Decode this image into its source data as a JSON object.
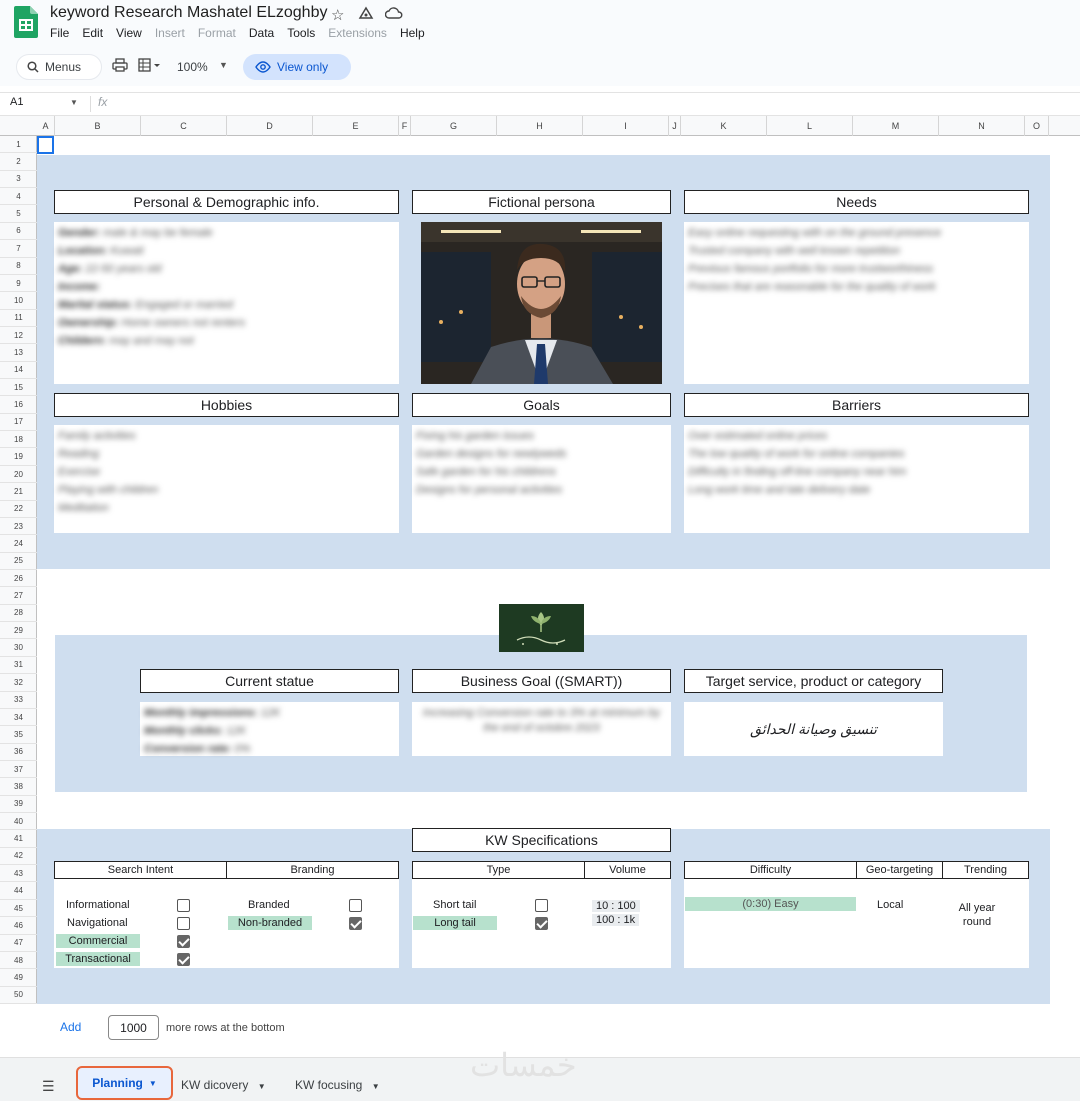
{
  "app": {
    "title": "keyword Research Mashatel ELzoghby",
    "menu": [
      "File",
      "Edit",
      "View",
      "Insert",
      "Format",
      "Data",
      "Tools",
      "Extensions",
      "Help"
    ],
    "menu_disabled": [
      "Insert",
      "Format",
      "Extensions"
    ],
    "menus_label": "Menus",
    "zoom": "100%",
    "view_only": "View only",
    "cell_ref": "A1",
    "fx": "fx"
  },
  "columns": [
    "A",
    "B",
    "C",
    "D",
    "E",
    "F",
    "G",
    "H",
    "I",
    "J",
    "K",
    "L",
    "M",
    "N",
    "O"
  ],
  "rows": [
    "1",
    "2",
    "3",
    "4",
    "5",
    "6",
    "7",
    "8",
    "9",
    "10",
    "11",
    "12",
    "13",
    "14",
    "15",
    "16",
    "17",
    "18",
    "19",
    "20",
    "21",
    "22",
    "23",
    "24",
    "25",
    "26",
    "27",
    "28",
    "29",
    "30",
    "31",
    "32",
    "33",
    "34",
    "35",
    "36",
    "37",
    "38",
    "39",
    "40",
    "41",
    "42",
    "43",
    "44",
    "45",
    "46",
    "47",
    "48",
    "49",
    "50"
  ],
  "persona": {
    "personal_title": "Personal & Demographic info.",
    "persona_title": "Fictional persona",
    "needs_title": "Needs",
    "hobbies_title": "Hobbies",
    "goals_title": "Goals",
    "barriers_title": "Barriers",
    "personal_lines": [
      {
        "k": "Gender:",
        "v": "male & may be female"
      },
      {
        "k": "Location:",
        "v": "Kuwait"
      },
      {
        "k": "Age:",
        "v": "22-50 years old"
      },
      {
        "k": "Income:",
        "v": ""
      },
      {
        "k": "Marital status:",
        "v": "Engaged or married"
      },
      {
        "k": "Ownership:",
        "v": "Home owners not renters"
      },
      {
        "k": "Childern:",
        "v": "may and may not"
      }
    ],
    "needs_lines": [
      "Easy online requesting with on the ground presence",
      "Trusted company with well known repetition",
      "Previous famous portfolio for more trustworthiness",
      "Precises that are reasonable for the quality of work"
    ],
    "hobbies_lines": [
      "Family activities",
      "Reading",
      "Exercise",
      "Playing with children",
      "Meditation"
    ],
    "goals_lines": [
      "Fixing his garden issues",
      "Garden designs for newlyweds",
      "Safe garden for his childrens",
      "Designs for personal activities"
    ],
    "barriers_lines": [
      "Over estimated online prices",
      "The low quality of work for online companies",
      "Difficulty in finding off-line company near him",
      "Long work time and late delivery date"
    ]
  },
  "business": {
    "current_title": "Current statue",
    "goal_title": "Business Goal ((SMART))",
    "target_title": "Target service, product or category",
    "current_lines": [
      {
        "k": "Monthly impressions:",
        "v": "12K"
      },
      {
        "k": "Monthly clicks:",
        "v": "12K"
      },
      {
        "k": "Conversion rate:",
        "v": "0%"
      }
    ],
    "goal_text": "Increasing Conversion rate to 3% at minimum by the end of octobre 2023",
    "target_text": "تنسيق وصيانة الحدائق"
  },
  "kw": {
    "title": "KW Specifications",
    "headers": {
      "intent": "Search Intent",
      "branding": "Branding",
      "type": "Type",
      "volume": "Volume",
      "difficulty": "Difficulty",
      "geo": "Geo-targeting",
      "trending": "Trending"
    },
    "intent": [
      {
        "label": "Informational",
        "checked": false,
        "hl": false
      },
      {
        "label": "Navigational",
        "checked": false,
        "hl": false
      },
      {
        "label": "Commercial",
        "checked": true,
        "hl": true
      },
      {
        "label": "Transactional",
        "checked": true,
        "hl": true
      }
    ],
    "branding": [
      {
        "label": "Branded",
        "checked": false,
        "hl": false
      },
      {
        "label": "Non-branded",
        "checked": true,
        "hl": true
      }
    ],
    "types": [
      {
        "label": "Short tail",
        "checked": false,
        "hl": false
      },
      {
        "label": "Long tail",
        "checked": true,
        "hl": true
      }
    ],
    "volume": [
      "10 : 100",
      "100 : 1k"
    ],
    "difficulty": "(0:30) Easy",
    "geo": "Local",
    "trending": "All year round"
  },
  "bottom": {
    "add": "Add",
    "rows": "1000",
    "more": "more rows at the bottom"
  },
  "tabs": [
    {
      "label": "Planning",
      "active": true
    },
    {
      "label": "KW dicovery",
      "active": false
    },
    {
      "label": "KW focusing",
      "active": false
    }
  ],
  "watermark": "خمسات",
  "colors": {
    "band": "#cfdeef",
    "green": "#b7e1cd",
    "accent": "#1a73e8",
    "active_tab_border": "#e8673c"
  }
}
